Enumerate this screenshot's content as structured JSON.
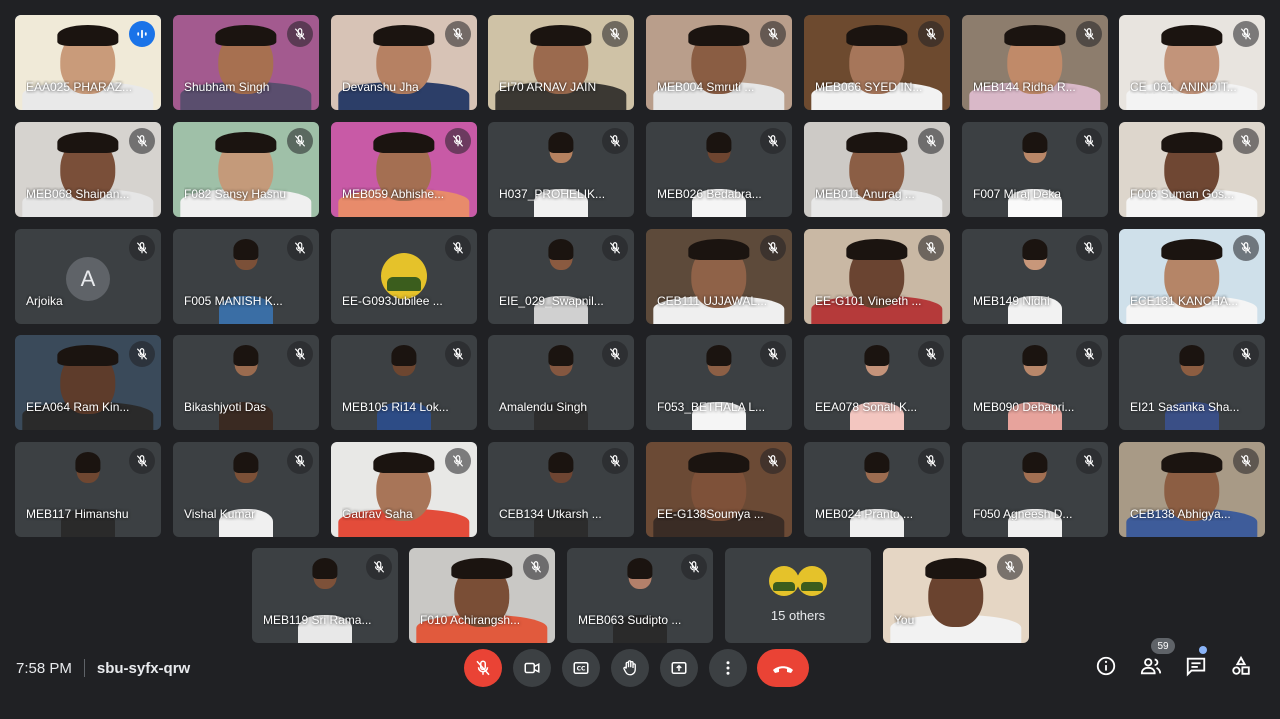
{
  "participants": [
    {
      "name": "EAA025 PHARAZ...",
      "speaking": true,
      "bg": "#f0ead8",
      "skin": "#c99b7a",
      "shirt": "#e9e9e9"
    },
    {
      "name": "Shubham Singh",
      "bg": "#a35a8f",
      "skin": "#a77050",
      "shirt": "#5a4e6e"
    },
    {
      "name": "Devanshu Jha",
      "bg": "#d7c3b6",
      "skin": "#b68163",
      "shirt": "#2c3e68"
    },
    {
      "name": "EI70 ARNAV JAIN",
      "bg": "#cfc2a6",
      "skin": "#9b6a4e",
      "shirt": "#3b3833"
    },
    {
      "name": "MEB004 Smruti ...",
      "bg": "#b99e8b",
      "skin": "#8a5d43",
      "shirt": "#e6e6e6"
    },
    {
      "name": "MEB066 SYED IN...",
      "bg": "#6d4a2f",
      "skin": "#a6765a",
      "shirt": "#f2f2f2"
    },
    {
      "name": "MEB144 Ridha R...",
      "bg": "#8d7d6d",
      "skin": "#c08a69",
      "shirt": "#d9b8c8"
    },
    {
      "name": "CE_061_ANINDIT...",
      "bg": "#e8e4df",
      "skin": "#c2947a",
      "shirt": "#f3f3f3"
    },
    {
      "name": "MEB068 Shainan...",
      "bg": "#d6d3cf",
      "skin": "#7a4f39",
      "shirt": "#e6e6e6"
    },
    {
      "name": "F082 Sansy Hasnu",
      "bg": "#9fc0a8",
      "skin": "#c49a7a",
      "shirt": "#f0f0f0"
    },
    {
      "name": "MEB059 Abhishe...",
      "bg": "#c85aa6",
      "skin": "#a46f52",
      "shirt": "#e88b6b"
    },
    {
      "name": "H037_PROHELIK...",
      "bg": "#3c4043",
      "skin": "#b5815f",
      "shirt": "#f1f1f1",
      "narrow": true
    },
    {
      "name": "MEB026 Bedabra...",
      "bg": "#3c4043",
      "skin": "#6e4530",
      "shirt": "#f5f5f5",
      "narrow": true
    },
    {
      "name": "MEB011 Anurag ...",
      "bg": "#cdcac6",
      "skin": "#8b5e45",
      "shirt": "#e8e8e8"
    },
    {
      "name": "F007 Miraj Deka",
      "bg": "#3c4043",
      "skin": "#b98768",
      "shirt": "#fafafa",
      "narrow": true
    },
    {
      "name": "F006 Suman Gos...",
      "bg": "#ddd6cc",
      "skin": "#6f4733",
      "shirt": "#f5f5f5"
    },
    {
      "name": "Arjoika",
      "avatar": "A"
    },
    {
      "name": "F005 MANISH K...",
      "bg": "#3c4043",
      "skin": "#7b5038",
      "shirt": "#3a6ea5",
      "narrow": true
    },
    {
      "name": "EE-G093Jubilee ...",
      "logo": true
    },
    {
      "name": "EIE_029_Swapnil...",
      "bg": "#3c4043",
      "skin": "#8a5a40",
      "shirt": "#d0d0d0",
      "narrow": true
    },
    {
      "name": "CEB111 UJJAWAL...",
      "bg": "#5d4a3a",
      "skin": "#8f6248",
      "shirt": "#efefef"
    },
    {
      "name": "EE-G101 Vineeth ...",
      "bg": "#c9b8a4",
      "skin": "#6a4431",
      "shirt": "#b53a3a"
    },
    {
      "name": "MEB149 Nidhi",
      "bg": "#3c4043",
      "skin": "#c8977a",
      "shirt": "#f2f2f2",
      "narrow": true
    },
    {
      "name": "ECE131 KANCHA...",
      "bg": "#cfe0ea",
      "skin": "#b58567",
      "shirt": "#f5f5f5"
    },
    {
      "name": "EEA064 Ram Kin...",
      "bg": "#3a4a5a",
      "skin": "#5e3c2b",
      "shirt": "#2a2a2a"
    },
    {
      "name": "Bikashjyoti Das",
      "bg": "#3c4043",
      "skin": "#9a6b4f",
      "shirt": "#3a2a22",
      "narrow": true
    },
    {
      "name": "MEB105 Ri14 Lok...",
      "bg": "#3c4043",
      "skin": "#6d4630",
      "shirt": "#2d4c86",
      "narrow": true
    },
    {
      "name": "Amalendu Singh",
      "bg": "#3c4043",
      "skin": "#845740",
      "shirt": "#2e2e2e",
      "narrow": true
    },
    {
      "name": "F053_BETHALA L...",
      "bg": "#3c4043",
      "skin": "#8c5f45",
      "shirt": "#f5f5f5",
      "narrow": true
    },
    {
      "name": "EEA078 Sonali K...",
      "bg": "#3c4043",
      "skin": "#c4937a",
      "shirt": "#f3c6c0",
      "narrow": true
    },
    {
      "name": "MEB090 Debapri...",
      "bg": "#3c4043",
      "skin": "#b8876a",
      "shirt": "#e7a39c",
      "narrow": true
    },
    {
      "name": "EI21 Sasanka Sha...",
      "bg": "#3c4043",
      "skin": "#8c5d41",
      "shirt": "#3a4f86",
      "narrow": true
    },
    {
      "name": "MEB117 Himanshu",
      "bg": "#3c4043",
      "skin": "#6f4731",
      "shirt": "#2a2a2a",
      "narrow": true
    },
    {
      "name": "Vishal Kumar",
      "bg": "#3c4043",
      "skin": "#7b5037",
      "shirt": "#f0f0f0",
      "narrow": true
    },
    {
      "name": "Gaurav Saha",
      "bg": "#e8e8e6",
      "skin": "#a87558",
      "shirt": "#e34c3a"
    },
    {
      "name": "CEB134 Utkarsh ...",
      "bg": "#3c4043",
      "skin": "#6e4532",
      "shirt": "#2c2c2c",
      "narrow": true
    },
    {
      "name": "EE-G138Soumya ...",
      "bg": "#6b4a35",
      "skin": "#7e5139",
      "shirt": "#3a2c25"
    },
    {
      "name": "MEB024 Pranto ...",
      "bg": "#3c4043",
      "skin": "#9c6c50",
      "shirt": "#efefef",
      "narrow": true
    },
    {
      "name": "F050 Agneesh D...",
      "bg": "#3c4043",
      "skin": "#a16f52",
      "shirt": "#f0f0f0",
      "narrow": true
    },
    {
      "name": "CEB138 Abhigya...",
      "bg": "#a89a86",
      "skin": "#8c5e43",
      "shirt": "#3e5c9a"
    },
    {
      "name": "MEB119 Sri Rama...",
      "bg": "#3c4043",
      "skin": "#7d5139",
      "shirt": "#e8e8e8",
      "narrow": true
    },
    {
      "name": "F010 Achirangsh...",
      "bg": "#c9c8c5",
      "skin": "#7a4e36",
      "shirt": "#e15a3d"
    },
    {
      "name": "MEB063 Sudipto ...",
      "bg": "#3c4043",
      "skin": "#b3806a",
      "shirt": "#2a2a2a",
      "narrow": true
    },
    {
      "name": "15 others",
      "others": true
    },
    {
      "name": "You",
      "bg": "#e5d6c4",
      "skin": "#6a432f",
      "shirt": "#f2f2f2"
    }
  ],
  "bottom_bar": {
    "time": "7:58 PM",
    "meeting_code": "sbu-syfx-qrw",
    "people_count": "59"
  },
  "colors": {
    "background": "#202124",
    "tile": "#3c4043",
    "hangup": "#ea4335",
    "accent": "#8ab4f8"
  }
}
